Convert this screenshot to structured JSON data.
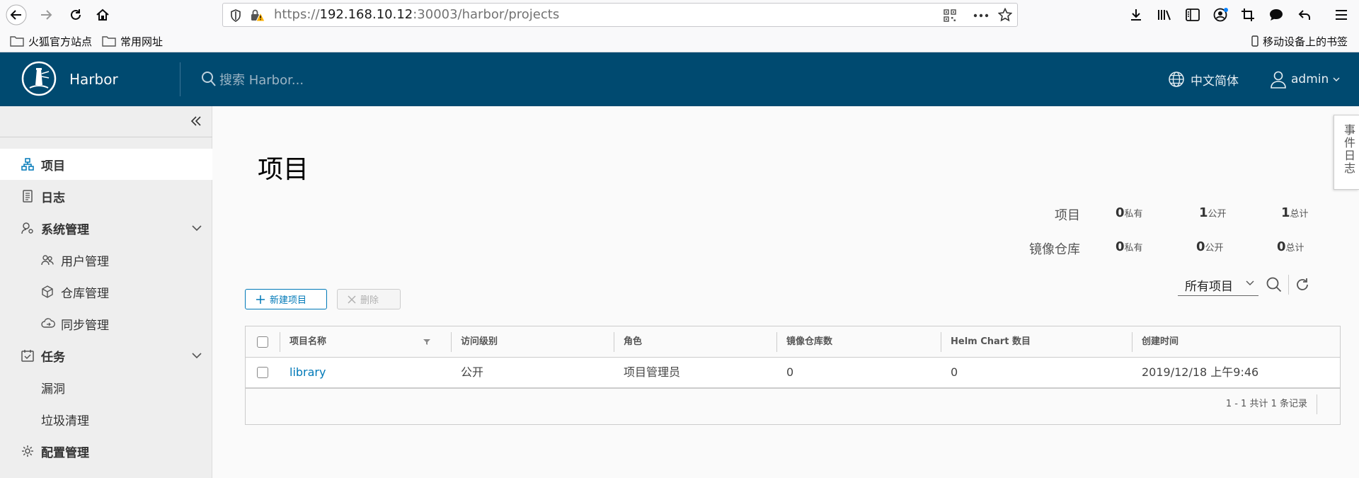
{
  "browser": {
    "url_prefix": "https://",
    "url_host": "192.168.10.12",
    "url_rest": ":30003/harbor/projects",
    "bookmarks": [
      "火狐官方站点",
      "常用网址"
    ],
    "mobile_bookmarks": "移动设备上的书签"
  },
  "header": {
    "brand": "Harbor",
    "search_placeholder": "搜索 Harbor...",
    "language": "中文简体",
    "user": "admin"
  },
  "sidebar": {
    "items": [
      {
        "label": "项目",
        "icon": "projects-icon"
      },
      {
        "label": "日志",
        "icon": "logs-icon"
      },
      {
        "label": "系统管理",
        "icon": "admin-icon"
      },
      {
        "label": "用户管理",
        "icon": "users-icon"
      },
      {
        "label": "仓库管理",
        "icon": "registries-icon"
      },
      {
        "label": "同步管理",
        "icon": "replication-icon"
      },
      {
        "label": "任务",
        "icon": "tasks-icon"
      },
      {
        "label": "漏洞"
      },
      {
        "label": "垃圾清理"
      },
      {
        "label": "配置管理",
        "icon": "gear-icon"
      }
    ]
  },
  "main": {
    "title": "项目",
    "stats": {
      "projects_label": "项目",
      "repos_label": "镜像仓库",
      "projects": {
        "private": "0",
        "public": "1",
        "total": "1"
      },
      "repos": {
        "private": "0",
        "public": "0",
        "total": "0"
      },
      "private_unit": "私有",
      "public_unit": "公开",
      "total_unit": "总计"
    },
    "new_button": "新建项目",
    "delete_button": "删除",
    "filter_value": "所有项目",
    "columns": [
      "项目名称",
      "访问级别",
      "角色",
      "镜像仓库数",
      "Helm Chart 数目",
      "创建时间"
    ],
    "rows": [
      {
        "name": "library",
        "access": "公开",
        "role": "项目管理员",
        "repos": "0",
        "charts": "0",
        "created": "2019/12/18 上午9:46"
      }
    ],
    "footer": "1 - 1 共计 1 条记录"
  },
  "event_tab": "事件日志",
  "colors": {
    "header_bg": "#004a70",
    "accent": "#0079b8",
    "sidebar_bg": "#eeeeee"
  }
}
